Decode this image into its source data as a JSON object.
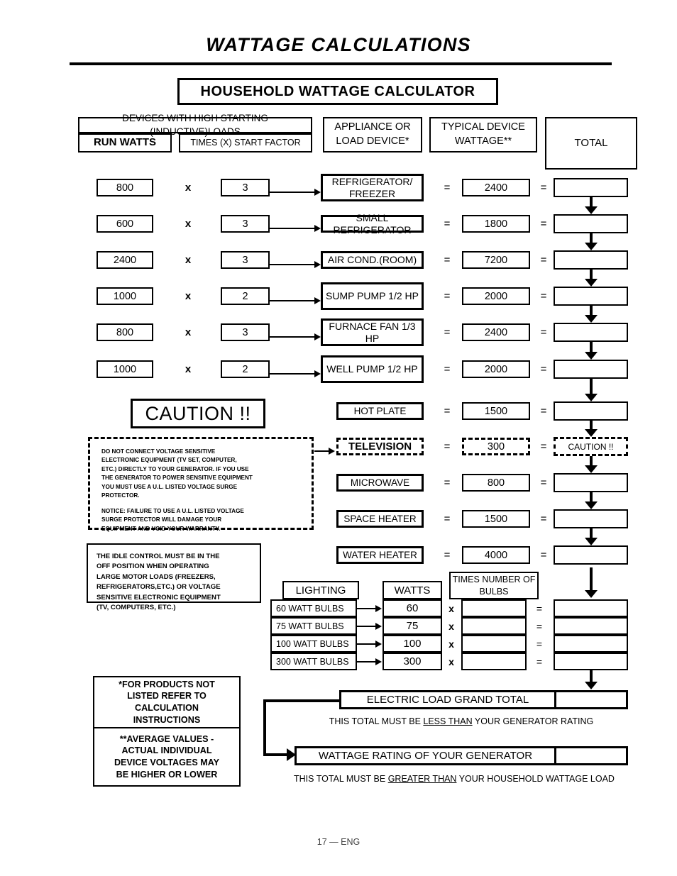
{
  "page": {
    "title": "WATTAGE CALCULATIONS",
    "banner": "HOUSEHOLD  WATTAGE  CALCULATOR",
    "footer": "17  —  ENG"
  },
  "headers": {
    "inductive_loads": "DEVICES WITH HIGH STARTING (INDUCTIVE)LOADS",
    "run_watts": "RUN WATTS",
    "start_factor": "TIMES (X) START FACTOR",
    "appliance": "APPLIANCE OR LOAD DEVICE*",
    "typical_wattage": "TYPICAL DEVICE WATTAGE**",
    "total": "TOTAL",
    "times_symbol": "x",
    "equals_symbol": "="
  },
  "inductive_rows": [
    {
      "run_watts": "800",
      "start_factor": "3",
      "device": "REFRIGERATOR/ FREEZER",
      "typical_wattage": "2400",
      "total": ""
    },
    {
      "run_watts": "600",
      "start_factor": "3",
      "device": "SMALL REFRIGERATOR",
      "typical_wattage": "1800",
      "total": ""
    },
    {
      "run_watts": "2400",
      "start_factor": "3",
      "device": "AIR COND.(ROOM)",
      "typical_wattage": "7200",
      "total": ""
    },
    {
      "run_watts": "1000",
      "start_factor": "2",
      "device": "SUMP PUMP 1/2 HP",
      "typical_wattage": "2000",
      "total": ""
    },
    {
      "run_watts": "800",
      "start_factor": "3",
      "device": "FURNACE FAN 1/3 HP",
      "typical_wattage": "2400",
      "total": ""
    },
    {
      "run_watts": "1000",
      "start_factor": "2",
      "device": "WELL PUMP 1/2 HP",
      "typical_wattage": "2000",
      "total": ""
    }
  ],
  "resistive_rows": [
    {
      "device": "HOT PLATE",
      "typical_wattage": "1500",
      "total": "",
      "dashed": false
    },
    {
      "device": "TELEVISION",
      "typical_wattage": "300",
      "total": "CAUTION !!",
      "dashed": true
    },
    {
      "device": "MICROWAVE",
      "typical_wattage": "800",
      "total": "",
      "dashed": false
    },
    {
      "device": "SPACE HEATER",
      "typical_wattage": "1500",
      "total": "",
      "dashed": false
    },
    {
      "device": "WATER HEATER",
      "typical_wattage": "4000",
      "total": "",
      "dashed": false
    }
  ],
  "caution": {
    "heading": "CAUTION !!",
    "paragraph_1": "DO NOT CONNECT VOLTAGE SENSITIVE\nELECTRONIC EQUIPMENT (TV SET, COMPUTER,\nETC.) DIRECTLY TO YOUR GENERATOR. IF YOU USE\nTHE GENERATOR TO POWER SENSITIVE EQUIPMENT\nYOU MUST USE A U.L. LISTED VOLTAGE SURGE\nPROTECTOR.",
    "paragraph_2": "NOTICE:  FAILURE TO USE A U.L. LISTED VOLTAGE\nSURGE PROTECTOR WILL DAMAGE YOUR\nEQUIPMENT AND VOID YOUR WARRANTY."
  },
  "idle_control": "THE IDLE CONTROL MUST BE IN THE\nOFF POSITION WHEN OPERATING\nLARGE MOTOR LOADS (FREEZERS,\nREFRIGERATORS,ETC.) OR VOLTAGE\nSENSITIVE ELECTRONIC EQUIPMENT\n(TV, COMPUTERS, ETC.)",
  "lighting": {
    "header_lighting": "LIGHTING",
    "header_watts": "WATTS",
    "header_bulbs": "TIMES NUMBER OF BULBS",
    "times_symbol": "x",
    "equals_symbol": "=",
    "rows": [
      {
        "name": "60 WATT BULBS",
        "watts": "60",
        "count": "",
        "total": ""
      },
      {
        "name": "75 WATT BULBS",
        "watts": "75",
        "count": "",
        "total": ""
      },
      {
        "name": "100 WATT BULBS",
        "watts": "100",
        "count": "",
        "total": ""
      },
      {
        "name": "300 WATT BULBS",
        "watts": "300",
        "count": "",
        "total": ""
      }
    ]
  },
  "footnotes": {
    "one": "*FOR PRODUCTS NOT\nLISTED REFER TO\nCALCULATION\nINSTRUCTIONS",
    "two": "**AVERAGE VALUES -\nACTUAL INDIVIDUAL\nDEVICE VOLTAGES MAY\nBE HIGHER OR LOWER"
  },
  "totals": {
    "grand_total_label": "ELECTRIC LOAD GRAND TOTAL",
    "grand_total_value": "",
    "note_less_prefix": "THIS TOTAL MUST BE ",
    "note_less_emphasis": "LESS THAN",
    "note_less_suffix": " YOUR GENERATOR RATING",
    "generator_label": "WATTAGE RATING OF YOUR GENERATOR",
    "generator_value": "",
    "note_greater_prefix": "THIS TOTAL MUST BE ",
    "note_greater_emphasis": "GREATER THAN",
    "note_greater_suffix": " YOUR HOUSEHOLD WATTAGE LOAD"
  },
  "colors": {
    "ink": "#000000",
    "paper": "#ffffff"
  }
}
